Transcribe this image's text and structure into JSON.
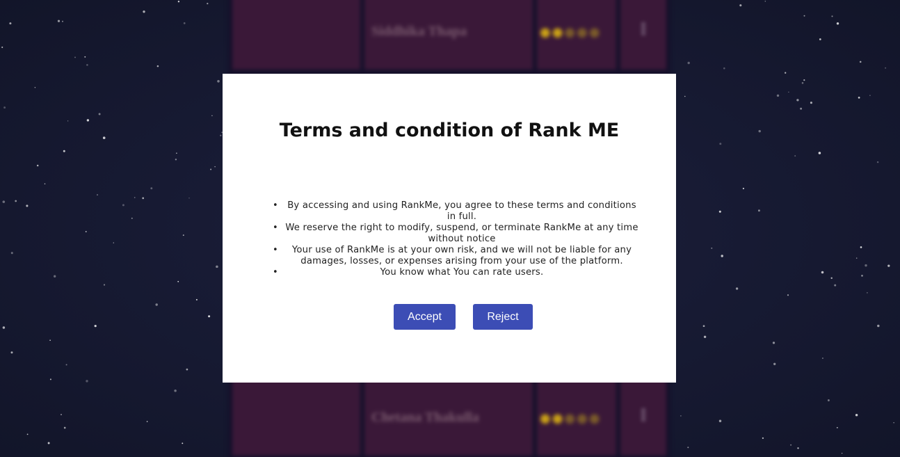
{
  "modal": {
    "title": "Terms and condition of Rank ME",
    "terms": [
      "By accessing and using RankMe, you agree to these terms and conditions in full.",
      "We reserve the right to modify, suspend, or terminate RankMe at any time without notice",
      "Your use of RankMe is at your own risk, and we will not be liable for any damages, losses, or expenses arising from your use of the platform.",
      "You know what You can rate users."
    ],
    "accept_label": "Accept",
    "reject_label": "Reject"
  },
  "background_leaderboard": {
    "rows": [
      {
        "name": "Siddhika Thapa",
        "rating": 2,
        "menu_icon": "more-icon"
      },
      {
        "name": "Chetana Thakulla",
        "rating": 2,
        "menu_icon": "more-icon"
      }
    ]
  },
  "colors": {
    "page_background": "#161a33",
    "row_background": "#3a1838",
    "button_background": "#3c4db5",
    "modal_background": "#ffffff",
    "star_color": "#c9a017"
  }
}
